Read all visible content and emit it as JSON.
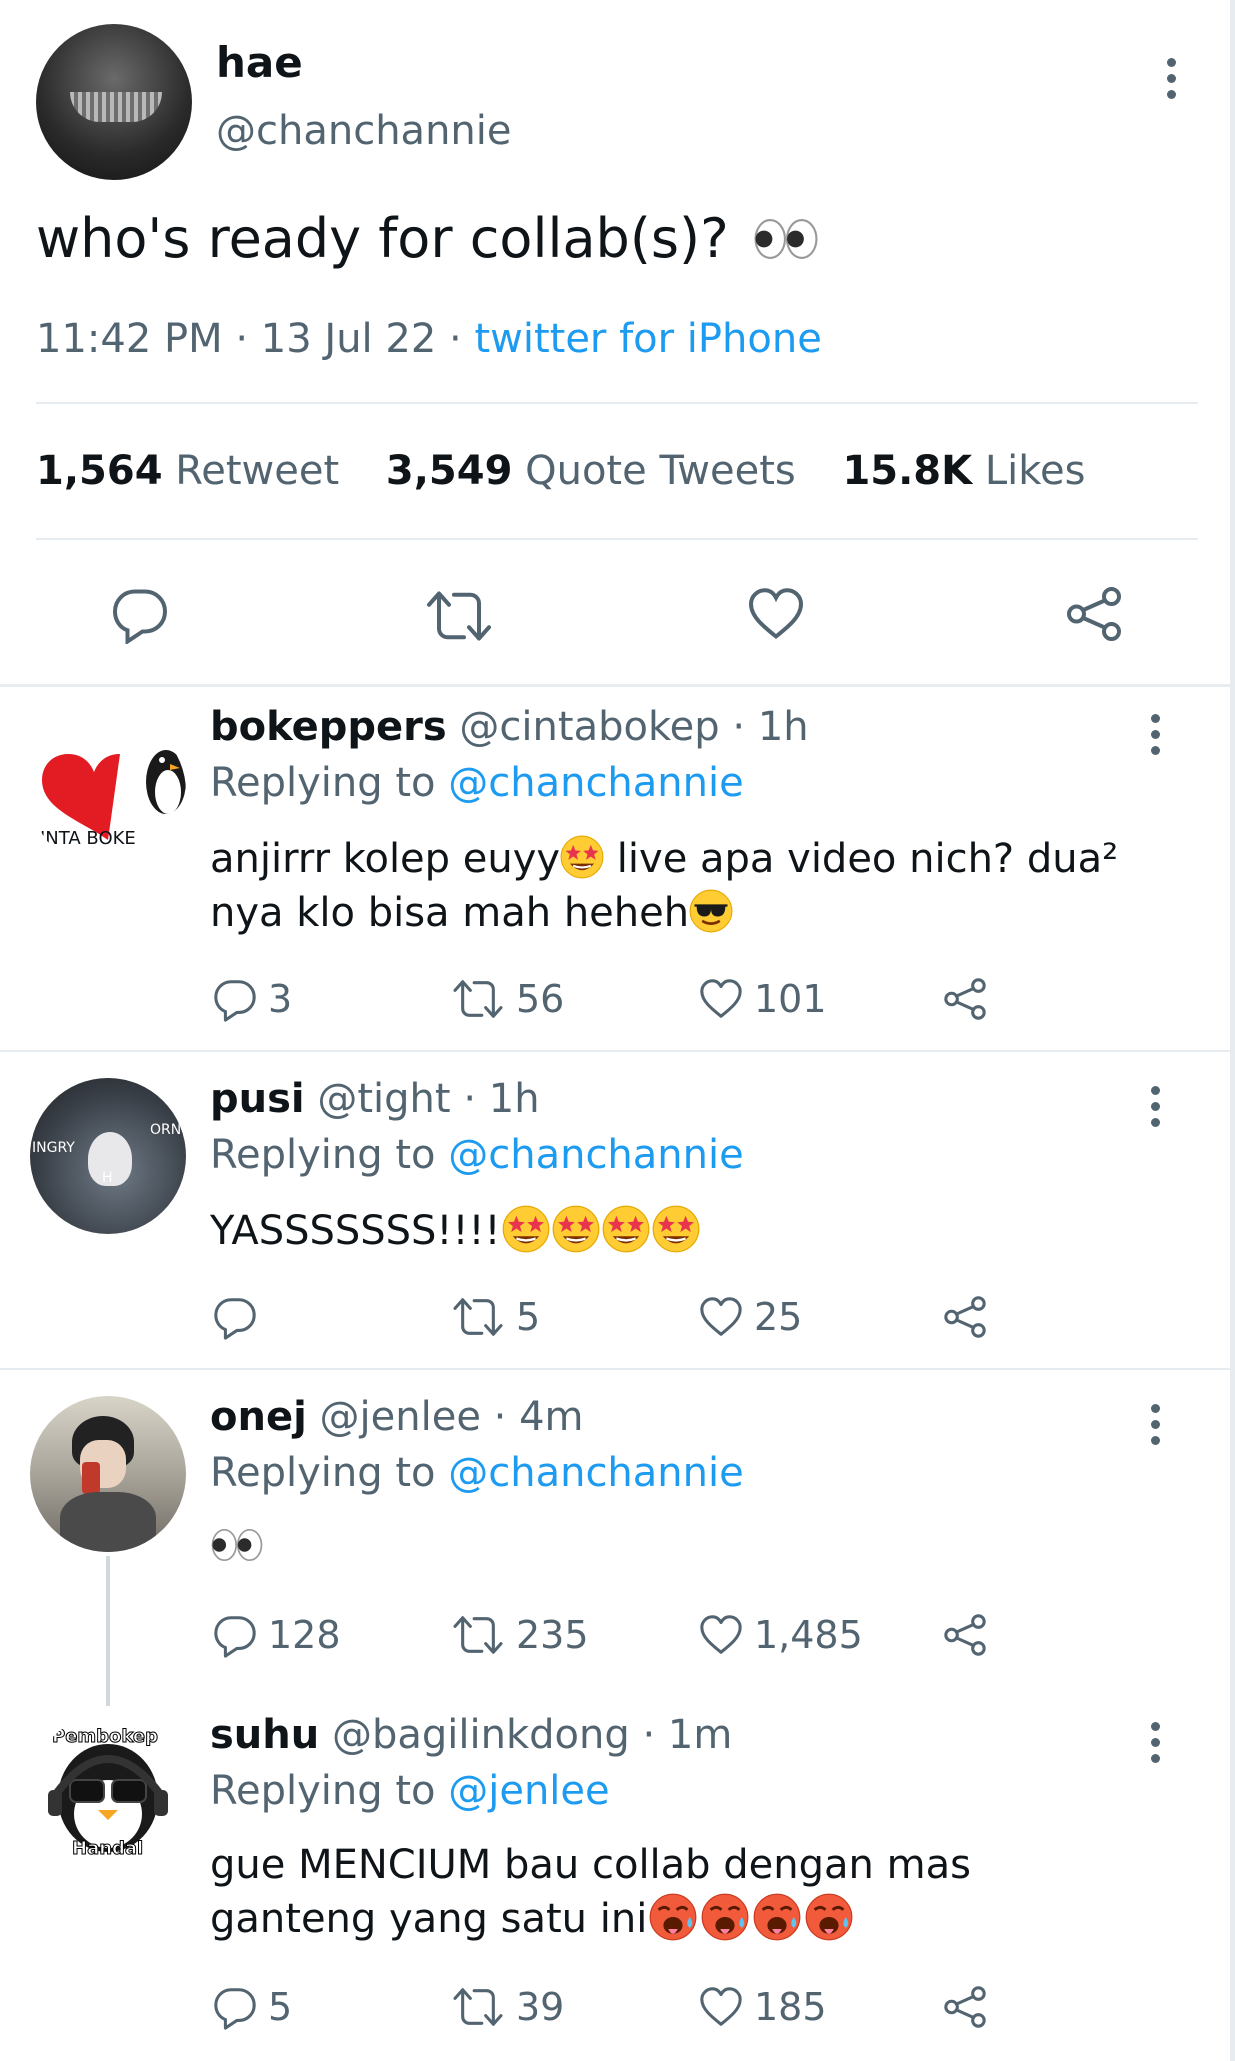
{
  "tweet": {
    "display_name": "hae",
    "handle": "@chanchannie",
    "text": "who's ready for collab(s)?",
    "emoji": "eyes",
    "time": "11:42 PM",
    "date": "13 Jul 22",
    "separator": "·",
    "source": "twitter for iPhone",
    "stats": {
      "retweets_count": "1,564",
      "retweets_label": "Retweet",
      "quotes_count": "3,549",
      "quotes_label": "Quote Tweets",
      "likes_count": "15.8K",
      "likes_label": "Likes"
    },
    "actions": [
      "reply-icon",
      "retweet-icon",
      "like-icon",
      "share-icon"
    ]
  },
  "replies": [
    {
      "display_name": "bokeppers",
      "handle": "@cintabokep",
      "time": "1h",
      "replying_label": "Replying to",
      "replying_to": "@chanchannie",
      "text_line1": "anjirrr kolep euyy",
      "text_line1b": " live apa video nich? dua²",
      "text_line2": "nya klo bisa mah heheh",
      "avatar_text": "INTA BOKE",
      "reply_count": "3",
      "retweet_count": "56",
      "like_count": "101"
    },
    {
      "display_name": "pusi",
      "handle": "@tight",
      "time": "1h",
      "replying_label": "Replying to",
      "replying_to": "@chanchannie",
      "text_line1": "YASSSSSSS!!!!",
      "avatar_text_left": "INGRY",
      "avatar_text_right": "ORN",
      "avatar_text_mid": "H",
      "reply_count": "",
      "retweet_count": "5",
      "like_count": "25"
    },
    {
      "display_name": "onej",
      "handle": "@jenlee",
      "time": "4m",
      "replying_label": "Replying to",
      "replying_to": "@chanchannie",
      "reply_count": "128",
      "retweet_count": "235",
      "like_count": "1,485"
    },
    {
      "display_name": "suhu",
      "handle": "@bagilinkdong",
      "time": "1m",
      "replying_label": "Replying to",
      "replying_to": "@jenlee",
      "text_line1": "gue MENCIUM bau collab dengan mas",
      "text_line2": "ganteng yang satu ini",
      "avatar_top": "Pembokep",
      "avatar_bottom": "Handal",
      "reply_count": "5",
      "retweet_count": "39",
      "like_count": "185"
    }
  ],
  "colors": {
    "text": "#0f1419",
    "secondary": "#536471",
    "link": "#1d9bf0",
    "divider": "#e6ecf0"
  }
}
